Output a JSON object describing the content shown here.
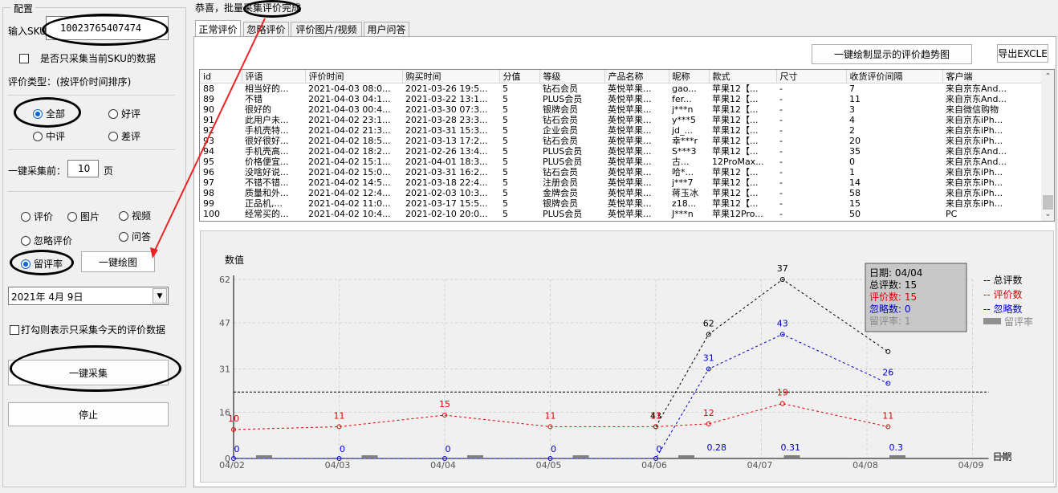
{
  "config": {
    "group_title": "配置",
    "sku_label": "输入SKU",
    "sku_value": "10023765407474",
    "only_current_sku_label": "是否只采集当前SKU的数据",
    "review_type_label": "评价类型：(按评价时间排序)",
    "type_options": [
      {
        "label": "全部",
        "selected": true
      },
      {
        "label": "好评",
        "selected": false
      },
      {
        "label": "中评",
        "selected": false
      },
      {
        "label": "差评",
        "selected": false
      }
    ],
    "collect_prefix": "一键采集前：",
    "page_count": "10",
    "page_suffix": "页",
    "chart_options": [
      {
        "label": "评价",
        "selected": false
      },
      {
        "label": "图片",
        "selected": false
      },
      {
        "label": "视频",
        "selected": false
      },
      {
        "label": "忽略评价",
        "selected": false
      },
      {
        "label": "问答",
        "selected": false
      },
      {
        "label": "留评率",
        "selected": true
      }
    ],
    "draw_button": "一键绘图",
    "date_value": "2021年  4月  9日",
    "today_only_label": "打勾则表示只采集今天的评价数据",
    "collect_button": "一键采集",
    "stop_button": "停止"
  },
  "status_text": "恭喜，批量采集评价完成",
  "tabs": [
    "正常评价",
    "忽略评价",
    "评价图片/视频",
    "用户问答"
  ],
  "trend_button": "一键绘制显示的评价趋势图",
  "export_button": "导出EXCLE",
  "table": {
    "columns": [
      "id",
      "评语",
      "评价时间",
      "购买时间",
      "分值",
      "等级",
      "产品名称",
      "昵称",
      "款式",
      "尺寸",
      "收货评价间隔",
      "客户端"
    ],
    "rows": [
      [
        "88",
        "相当好的...",
        "2021-04-03 08:0...",
        "2021-03-26 19:5...",
        "5",
        "钻石会员",
        "英悦苹果...",
        "gao...",
        "苹果12【...",
        "-",
        "7",
        "来自京东And..."
      ],
      [
        "89",
        "不错",
        "2021-04-03 04:1...",
        "2021-03-22 13:1...",
        "5",
        "PLUS会员",
        "英悦苹果...",
        "fer...",
        "苹果12【...",
        "-",
        "11",
        "来自京东And..."
      ],
      [
        "90",
        "很好的",
        "2021-04-03 00:4...",
        "2021-03-30 07:3...",
        "5",
        "银牌会员",
        "英悦苹果...",
        "j***n",
        "苹果12【...",
        "-",
        "3",
        "来自微信购物"
      ],
      [
        "91",
        "此用户未...",
        "2021-04-02 23:1...",
        "2021-03-28 23:3...",
        "5",
        "钻石会员",
        "英悦苹果...",
        "y***5",
        "苹果12【...",
        "-",
        "4",
        "来自京东iPh..."
      ],
      [
        "92",
        "手机壳特...",
        "2021-04-02 21:3...",
        "2021-03-31 15:3...",
        "5",
        "企业会员",
        "英悦苹果...",
        "jd_...",
        "苹果12【...",
        "-",
        "2",
        "来自京东iPh..."
      ],
      [
        "93",
        "很好很好...",
        "2021-04-02 18:5...",
        "2021-03-13 17:2...",
        "5",
        "钻石会员",
        "英悦苹果...",
        "幸***r",
        "苹果12【...",
        "-",
        "20",
        "来自京东iPh..."
      ],
      [
        "94",
        "手机壳高...",
        "2021-04-02 18:2...",
        "2021-02-26 13:4...",
        "5",
        "PLUS会员",
        "英悦苹果...",
        "S***3",
        "苹果12【...",
        "-",
        "35",
        "来自京东And..."
      ],
      [
        "95",
        "价格便宜...",
        "2021-04-02 15:1...",
        "2021-04-01 18:3...",
        "5",
        "PLUS会员",
        "英悦苹果...",
        "古...",
        "12ProMax...",
        "-",
        "0",
        "来自京东And..."
      ],
      [
        "96",
        "没啥好说...",
        "2021-04-02 15:0...",
        "2021-03-31 16:2...",
        "5",
        "钻石会员",
        "英悦苹果...",
        "哈*...",
        "苹果12【...",
        "-",
        "1",
        "来自京东iPh..."
      ],
      [
        "97",
        "不错不错...",
        "2021-04-02 14:5...",
        "2021-03-18 22:4...",
        "5",
        "注册会员",
        "英悦苹果...",
        "j***7",
        "苹果12【...",
        "-",
        "14",
        "来自京东iPh..."
      ],
      [
        "98",
        "质量和外...",
        "2021-04-02 12:4...",
        "2021-02-03 10:3...",
        "5",
        "金牌会员",
        "英悦苹果...",
        "蒋玉冰",
        "苹果12【...",
        "-",
        "58",
        "来自京东iPh..."
      ],
      [
        "99",
        "正品机,...",
        "2021-04-02 11:0...",
        "2021-03-17 15:5...",
        "5",
        "银牌会员",
        "英悦苹果...",
        "z18...",
        "苹果12【...",
        "-",
        "15",
        "来自京东iPh..."
      ],
      [
        "100",
        "经常买的...",
        "2021-04-02 10:4...",
        "2021-02-10 20:0...",
        "5",
        "PLUS会员",
        "英悦苹果...",
        "J***n",
        "苹果12Pro...",
        "-",
        "50",
        "PC"
      ]
    ]
  },
  "chart_data": {
    "type": "line",
    "ylabel": "数值",
    "xlabel": "日期",
    "x_ticks": [
      "04/02",
      "04/03",
      "04/04",
      "04/05",
      "04/06",
      "04/07",
      "04/08",
      "04/09"
    ],
    "y_ticks": [
      "0",
      "16",
      "31",
      "47",
      "62"
    ],
    "ylim": [
      0,
      62
    ],
    "grid": true,
    "legend_position": "right",
    "x": [
      "04/02",
      "04/03",
      "04/04",
      "04/05",
      "04/06",
      "04/06.5",
      "04/07",
      "04/08"
    ],
    "series": [
      {
        "name": "总评数",
        "color": "#000000",
        "points": [
          [
            0,
            null
          ],
          [
            1,
            null
          ],
          [
            2,
            null
          ],
          [
            3,
            null
          ],
          [
            4,
            11
          ],
          [
            4.5,
            43
          ],
          [
            5.2,
            62
          ],
          [
            6.2,
            37
          ]
        ]
      },
      {
        "name": "评价数",
        "color": "#e00000",
        "points": [
          [
            0,
            10
          ],
          [
            1,
            11
          ],
          [
            2,
            15
          ],
          [
            3,
            11
          ],
          [
            4,
            11
          ],
          [
            4.5,
            12
          ],
          [
            5.2,
            19
          ],
          [
            6.2,
            11
          ]
        ]
      },
      {
        "name": "忽略数",
        "color": "#0000cc",
        "points": [
          [
            0,
            0
          ],
          [
            1,
            0
          ],
          [
            2,
            0
          ],
          [
            3,
            0
          ],
          [
            4,
            0
          ],
          [
            4.5,
            31
          ],
          [
            5.2,
            43
          ],
          [
            6.2,
            26
          ]
        ]
      },
      {
        "name": "留评率",
        "color": "#808080",
        "points": [
          [
            4.5,
            0.28
          ],
          [
            5.2,
            0.31
          ],
          [
            6.2,
            0.3
          ]
        ]
      }
    ],
    "point_labels": {
      "total": [
        "43",
        "62",
        "37"
      ],
      "reviews": [
        "10",
        "11",
        "15",
        "11",
        "11",
        "12",
        "19",
        "11"
      ],
      "ignored": [
        "0",
        "0",
        "0",
        "0",
        "0",
        "31",
        "43",
        "26"
      ],
      "rate": [
        "0.28",
        "0.31",
        "0.3"
      ]
    },
    "reference_line": 23,
    "tooltip": {
      "date": "日期: 04/04",
      "total": "总评数: 15",
      "reviews": "评价数: 15",
      "ignored": "忽略数: 0",
      "rate": "留评率: 1"
    },
    "legend": [
      "-- 总评数",
      "-- 评价数",
      "-- 忽略数",
      "留评率"
    ]
  }
}
